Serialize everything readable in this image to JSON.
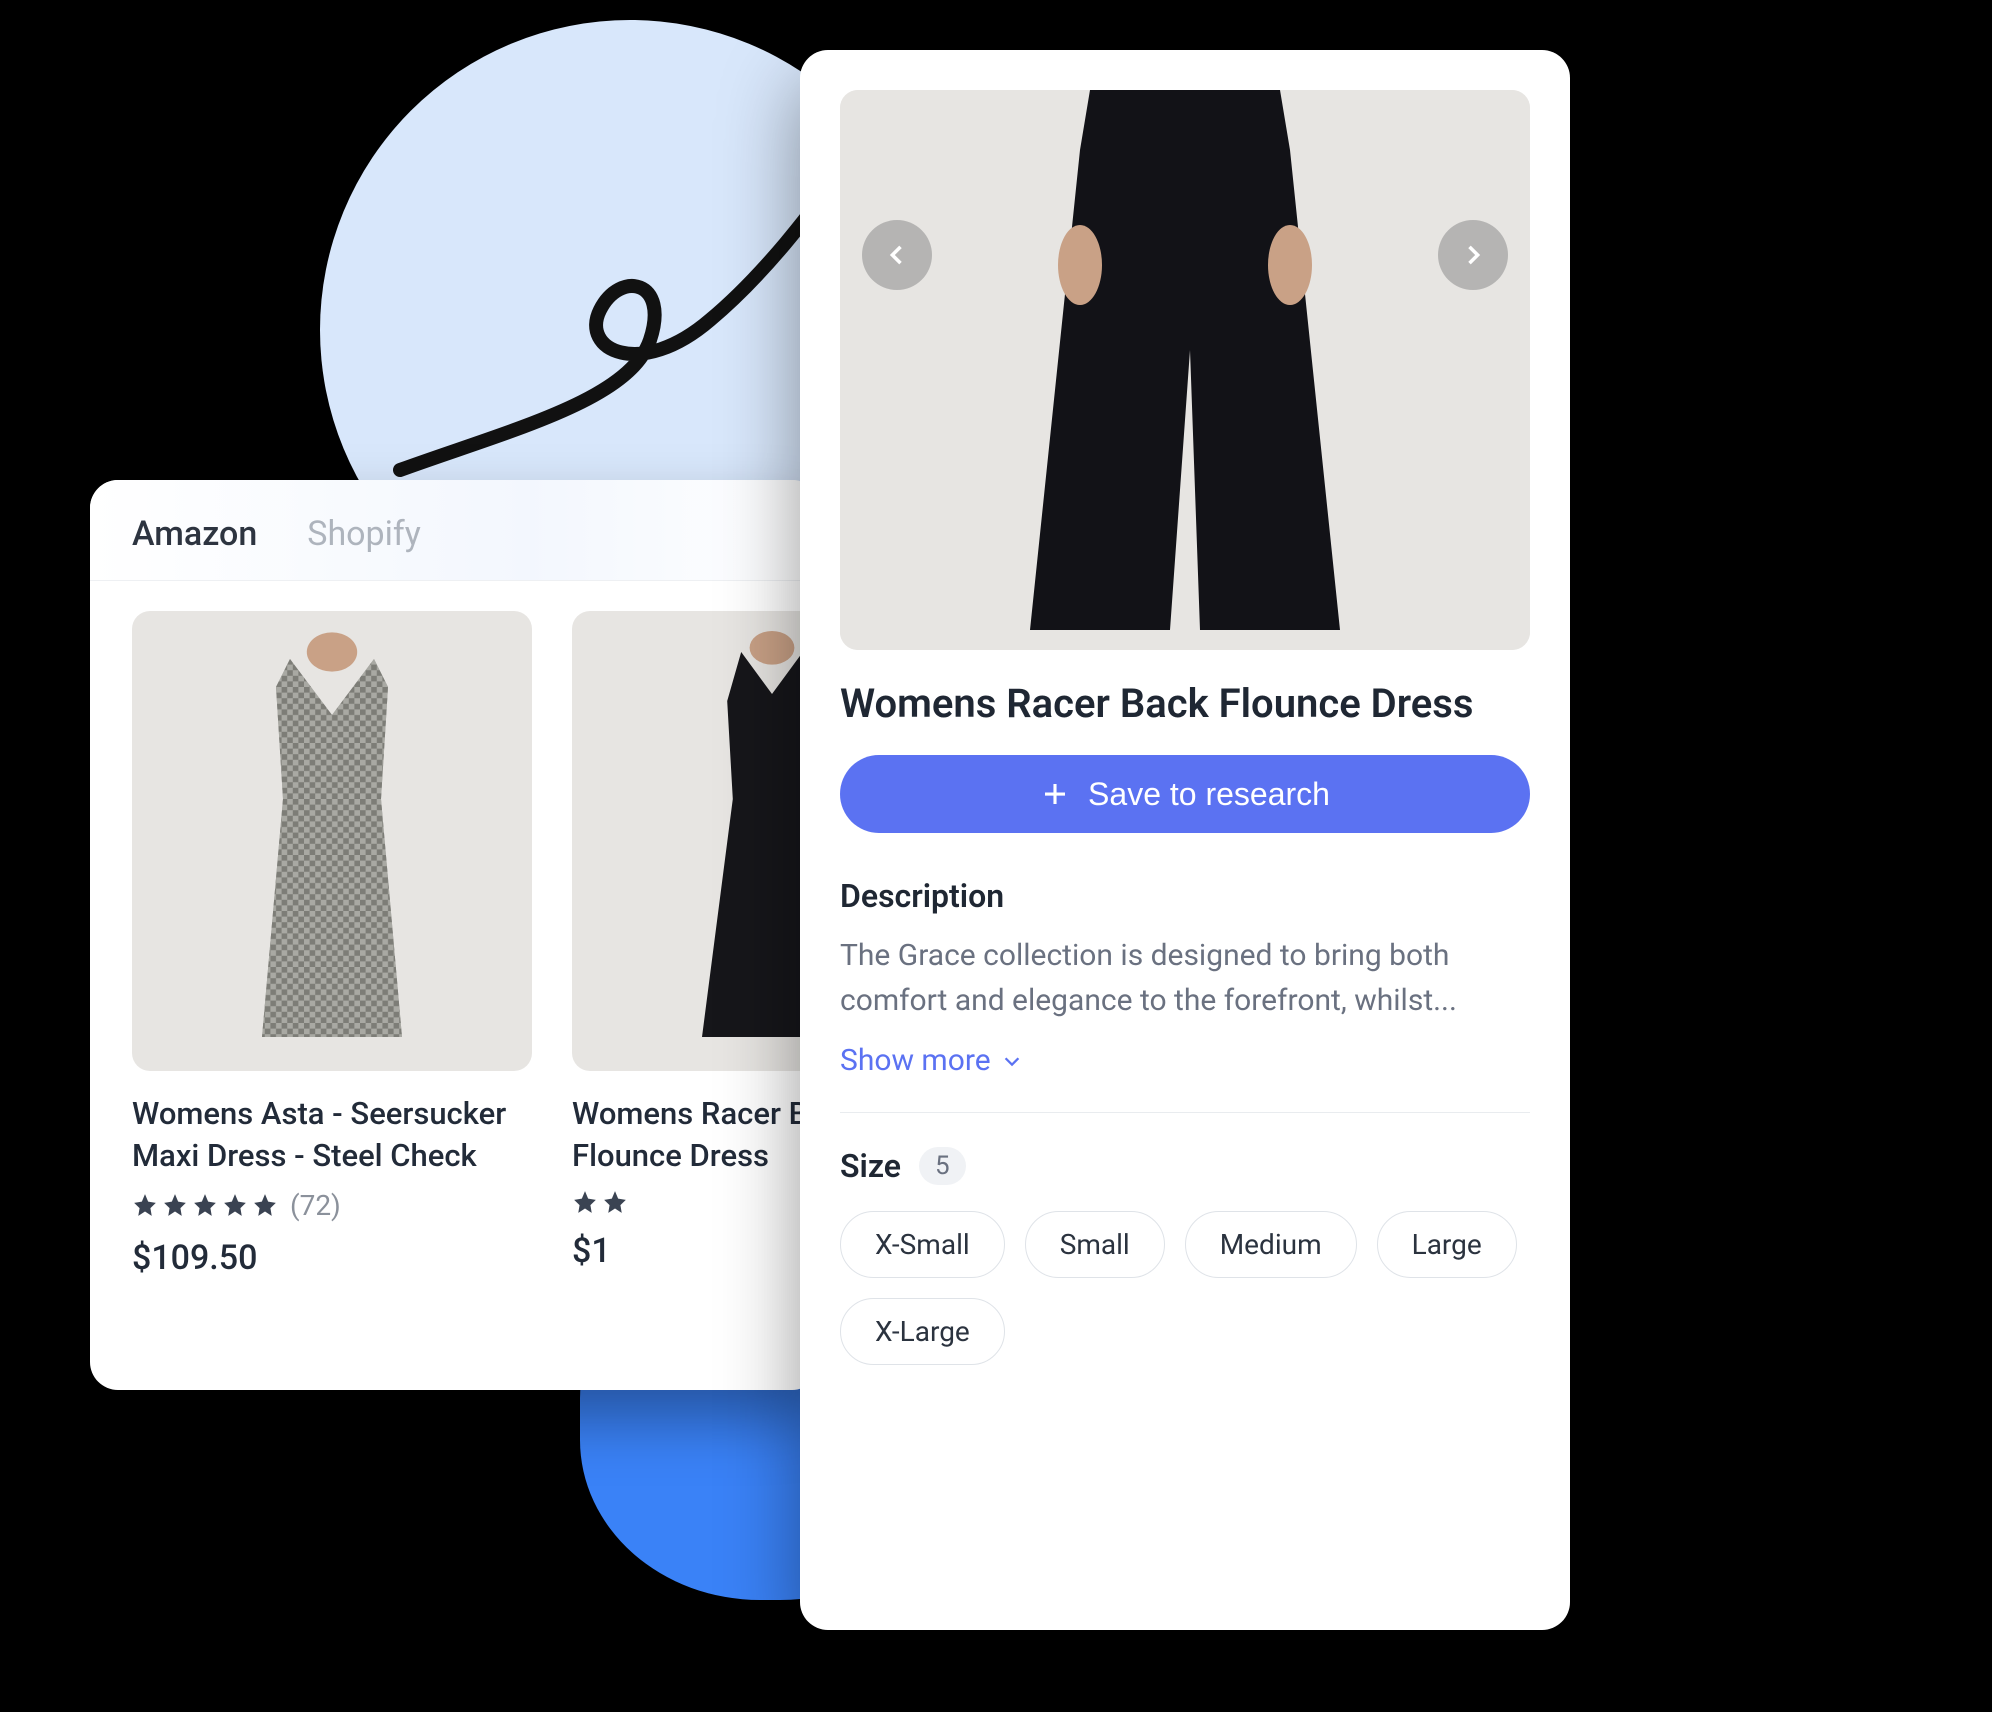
{
  "tabs": {
    "active": "Amazon",
    "inactive": "Shopify"
  },
  "products": [
    {
      "title": "Womens Asta - Seersucker Maxi Dress - Steel Check",
      "rating_count": "(72)",
      "price": "$109.50"
    },
    {
      "title": "Womens Racer Back Flounce Dress",
      "rating_count": "",
      "price": "$1"
    }
  ],
  "detail": {
    "title": "Womens Racer Back Flounce Dress",
    "save_label": "Save to research",
    "description_heading": "Description",
    "description_text": "The Grace collection is designed to bring both comfort and elegance to the forefront, whilst...",
    "show_more": "Show more",
    "size_label": "Size",
    "size_count": "5",
    "sizes": [
      "X-Small",
      "Small",
      "Medium",
      "Large",
      "X-Large"
    ]
  },
  "icons": {
    "plus": "plus-icon",
    "chevron_left": "chevron-left-icon",
    "chevron_right": "chevron-right-icon",
    "chevron_down": "chevron-down-icon",
    "star": "star-icon"
  }
}
